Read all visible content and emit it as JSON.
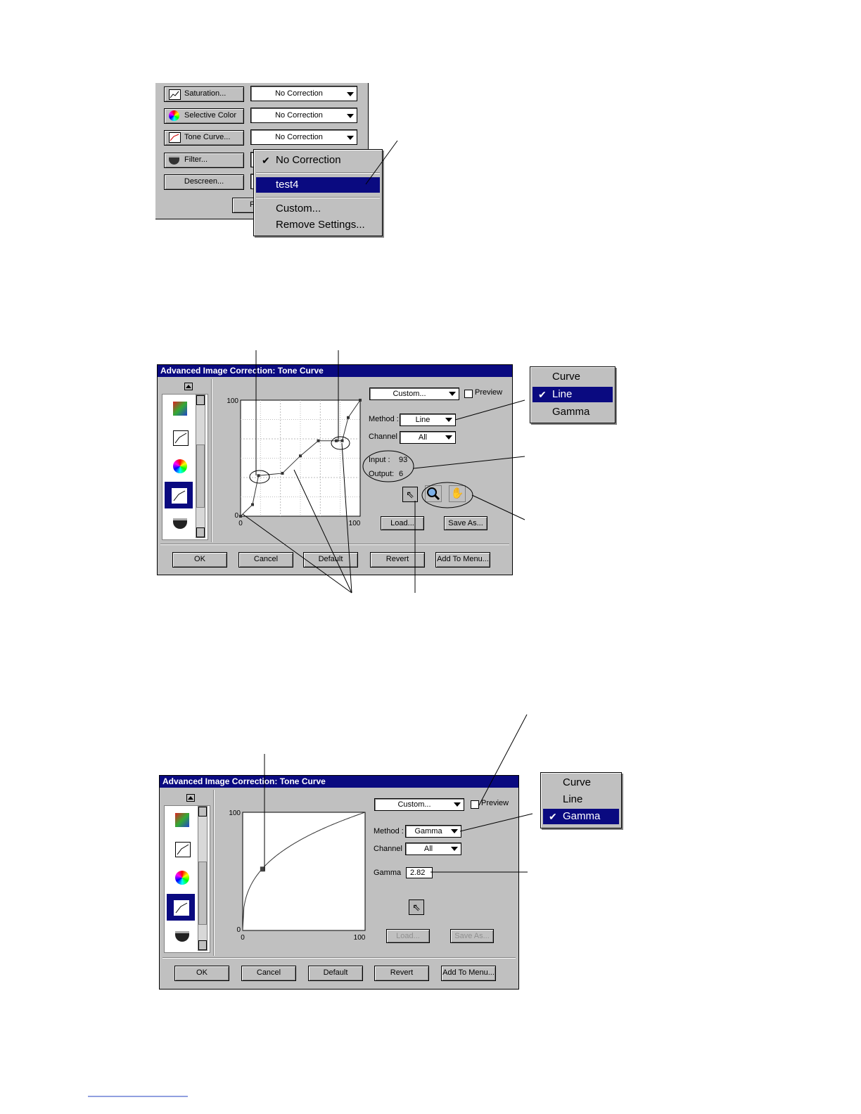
{
  "panel1": {
    "rows": [
      {
        "label": "Saturation...",
        "value": "No Correction",
        "icon": "saturation-icon"
      },
      {
        "label": "Selective Color",
        "value": "No Correction",
        "icon": "color-wheel-icon"
      },
      {
        "label": "Tone Curve...",
        "value": "No Correction",
        "icon": "tone-curve-icon"
      },
      {
        "label": "Filter...",
        "value": "",
        "icon": "filter-icon"
      },
      {
        "label": "Descreen...",
        "value": ""
      }
    ],
    "partial_button": "F",
    "menu": {
      "items": [
        "No Correction",
        "test4",
        "Custom...",
        "Remove Settings..."
      ],
      "checked": "No Correction",
      "highlighted": "test4"
    }
  },
  "dialog1": {
    "title": "Advanced Image Correction: Tone Curve",
    "preset": "Custom...",
    "preview_label": "Preview",
    "method_label": "Method :",
    "method_value": "Line",
    "channel_label": "Channel :",
    "channel_value": "All",
    "input_label": "Input :",
    "input_value": "93",
    "output_label": "Output:",
    "output_value": "6",
    "load_label": "Load...",
    "save_label": "Save As...",
    "axis": {
      "y_max": "100",
      "y_min": "0",
      "x_min": "0",
      "x_max": "100"
    },
    "buttons": [
      "OK",
      "Cancel",
      "Default",
      "Revert",
      "Add To Menu..."
    ],
    "method_menu": {
      "items": [
        "Curve",
        "Line",
        "Gamma"
      ],
      "selected": "Line"
    }
  },
  "dialog2": {
    "title": "Advanced Image Correction: Tone Curve",
    "preset": "Custom...",
    "preview_label": "Preview",
    "method_label": "Method :",
    "method_value": "Gamma",
    "channel_label": "Channel :",
    "channel_value": "All",
    "gamma_label": "Gamma",
    "gamma_value": "2.82",
    "load_label": "Load...",
    "save_label": "Save As...",
    "axis": {
      "y_max": "100",
      "y_min": "0",
      "x_min": "0",
      "x_max": "100"
    },
    "buttons": [
      "OK",
      "Cancel",
      "Default",
      "Revert",
      "Add To Menu..."
    ],
    "method_menu": {
      "items": [
        "Curve",
        "Line",
        "Gamma"
      ],
      "selected": "Gamma"
    }
  },
  "chart_data": [
    {
      "type": "line",
      "x": [
        0,
        10,
        15,
        35,
        50,
        65,
        80,
        85,
        90,
        100
      ],
      "y": [
        0,
        10,
        35,
        37,
        52,
        65,
        65,
        65,
        85,
        100
      ],
      "xlim": [
        0,
        100
      ],
      "ylim": [
        0,
        100
      ],
      "grid": true
    },
    {
      "type": "line",
      "gamma": 2.82,
      "xlim": [
        0,
        100
      ],
      "ylim": [
        0,
        100
      ],
      "grid": false
    }
  ]
}
